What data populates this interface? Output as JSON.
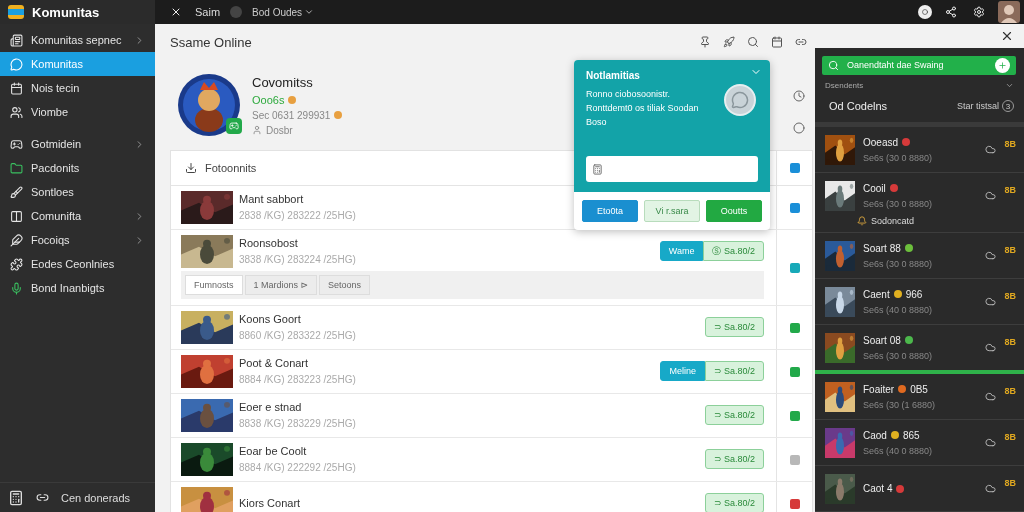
{
  "top_bar": {
    "app_name": "Komunitas",
    "tab_label": "Saim",
    "menu_label": "Bod Oudes"
  },
  "sidebar": {
    "items": [
      {
        "label": "Komunitas sepnec",
        "kind": "group",
        "selected": false
      },
      {
        "label": "Komunitas",
        "kind": "link",
        "selected": true
      },
      {
        "label": "Nois tecin",
        "kind": "link",
        "selected": false
      },
      {
        "label": "Viombe",
        "kind": "link",
        "selected": false
      },
      {
        "label": "Gotmidein",
        "kind": "group",
        "selected": false
      },
      {
        "label": "Pacdonits",
        "kind": "link",
        "selected": false
      },
      {
        "label": "Sontloes",
        "kind": "link",
        "selected": false
      },
      {
        "label": "Comunifta",
        "kind": "group",
        "selected": false
      },
      {
        "label": "Focoiqs",
        "kind": "group",
        "selected": false
      },
      {
        "label": "Eodes Ceonlnies",
        "kind": "link",
        "selected": false
      },
      {
        "label": "Bond Inanbigts",
        "kind": "link",
        "selected": false
      }
    ],
    "footer": "Cen donerads"
  },
  "header": {
    "title": "Ssame Online"
  },
  "profile": {
    "name": "Covomitss",
    "status": "Ooo6s",
    "id_line": "Sec 0631 299931",
    "location": "Dosbr"
  },
  "library": {
    "title": "Fotoonnits",
    "rows": [
      {
        "title": "Mant sabbort",
        "subtitle": "2838 /KG)  283222 /25HG)",
        "color": "#1a8fd8"
      },
      {
        "title": "Roonsobost",
        "subtitle": "3838 /KG)  283224 /25HG)",
        "tag": "Wame",
        "action": "Ⓢ Sa.80/2",
        "color": "#17a9b8",
        "chips": [
          "Fumnosts",
          "1 Mardions ⊳",
          "Setoons"
        ]
      },
      {
        "title": "Koons Goort",
        "subtitle": "8860 /KG)  283322 /25HG)",
        "action": "⊃ Sa.80/2",
        "color": "#22a94a"
      },
      {
        "title": "Poot & Conart",
        "subtitle": "8884 /KG)  283223 /25HG)",
        "tag": "Meline",
        "action": "⊃ Sa.80/2",
        "color": "#22a94a"
      },
      {
        "title": "Eoer e stnad",
        "subtitle": "8838 /KG)  283229 /25HG)",
        "action": "⊃ Sa.80/2",
        "color": "#22a94a"
      },
      {
        "title": "Eoar be Coolt",
        "subtitle": "8884 /KG)  222292 /25HG)",
        "action": "⊃ Sa.80/2",
        "color": "#b8b8b8"
      },
      {
        "title": "Kiors Conart",
        "action": "⊃ Sa.80/2",
        "color": "#d63a3a"
      }
    ]
  },
  "popup": {
    "title": "Notlamitias",
    "message": "Ronno ciobosoonistr. Ronttdemt0 os tiliak Soodan Boso",
    "buttons": [
      {
        "label": "Eto0ta",
        "kind": "primary"
      },
      {
        "label": "Vi r.sara",
        "kind": "light"
      },
      {
        "label": "Ooutts",
        "kind": "success"
      }
    ]
  },
  "friends_panel": {
    "cta": "Oanendtaht dae Swaing",
    "caption": "Dsendents",
    "heading": "Od Codelns",
    "filter": "Star tistsal",
    "filter_count": "3",
    "friends": [
      {
        "name": "Ooeasd",
        "color": "#d63a3a",
        "detail": "Se6s (30 0 8880)",
        "score": "8B",
        "highlighted": false
      },
      {
        "name": "Cooil",
        "color": "#d63a3a",
        "detail": "Se6s (30 0 8880)",
        "score": "8B",
        "note": "Sodoncatd",
        "highlighted": false
      },
      {
        "name": "Soart 88",
        "color": "#6cbf3c",
        "detail": "Se6s (30 0 8880)",
        "score": "8B",
        "highlighted": false
      },
      {
        "name": "Caent",
        "suffix": "966",
        "color": "#e0b020",
        "detail": "Se6s (40 0 8880)",
        "score": "8B",
        "highlighted": false
      },
      {
        "name": "Soart 08",
        "color": "#4cb84c",
        "detail": "Se6s (30 0 8880)",
        "score": "8B",
        "highlighted": true
      },
      {
        "name": "Foaiter",
        "suffix": "0B5",
        "color": "#e06a20",
        "detail": "Se6s (30 (1 6880)",
        "score": "8B",
        "highlighted": false
      },
      {
        "name": "Caod",
        "suffix": "865",
        "color": "#e0b020",
        "detail": "Se6s (40 0 8880)",
        "score": "8B",
        "highlighted": false
      },
      {
        "name": "Caot 4",
        "color": "#d63a3a",
        "score": "8B",
        "highlighted": false
      }
    ]
  }
}
